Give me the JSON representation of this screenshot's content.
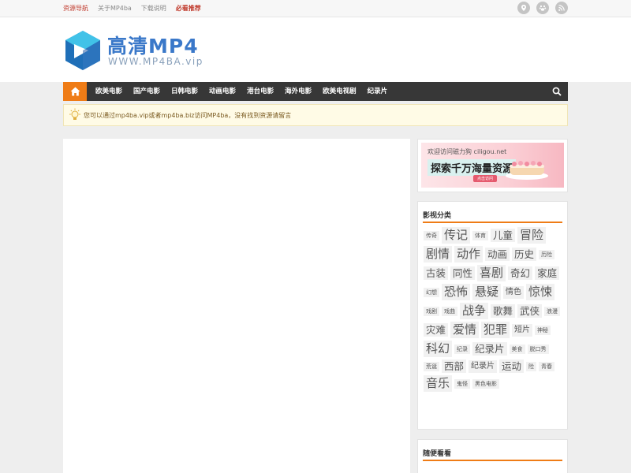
{
  "topbar": {
    "links": [
      {
        "label": "资源导航",
        "style": "red"
      },
      {
        "label": "关于MP4ba",
        "style": "normal"
      },
      {
        "label": "下载说明",
        "style": "normal"
      },
      {
        "label": "必看推荐",
        "style": "red-bold"
      }
    ],
    "icons": [
      "location-icon",
      "paw-icon",
      "rss-icon"
    ]
  },
  "header": {
    "logo_title": "高清MP4",
    "logo_subtitle": "WWW.MP4BA.vip"
  },
  "nav": {
    "items": [
      "欧美电影",
      "国产电影",
      "日韩电影",
      "动画电影",
      "港台电影",
      "海外电影",
      "欧美电视剧",
      "纪录片"
    ]
  },
  "notice": {
    "text": "您可以通过mp4ba.vip或者mp4ba.biz访问MP4ba，没有找到资源请留言"
  },
  "ad": {
    "small_text": "欢迎访问磁力狗 ciligou.net",
    "big_text": "探索千万海量资源",
    "button": "点击访问"
  },
  "categories": {
    "title": "影视分类",
    "tags": [
      {
        "label": "传奇",
        "size": 1
      },
      {
        "label": "传记",
        "size": 4
      },
      {
        "label": "体育",
        "size": 1
      },
      {
        "label": "儿童",
        "size": 3
      },
      {
        "label": "冒险",
        "size": 4
      },
      {
        "label": "剧情",
        "size": 4
      },
      {
        "label": "动作",
        "size": 4
      },
      {
        "label": "动画",
        "size": 3
      },
      {
        "label": "历史",
        "size": 3
      },
      {
        "label": "历险",
        "size": 1
      },
      {
        "label": "古装",
        "size": 3
      },
      {
        "label": "同性",
        "size": 3
      },
      {
        "label": "喜剧",
        "size": 4
      },
      {
        "label": "奇幻",
        "size": 3
      },
      {
        "label": "家庭",
        "size": 3
      },
      {
        "label": "幻想",
        "size": 1
      },
      {
        "label": "恐怖",
        "size": 4
      },
      {
        "label": "悬疑",
        "size": 4
      },
      {
        "label": "情色",
        "size": 2
      },
      {
        "label": "惊悚",
        "size": 4
      },
      {
        "label": "戏剧",
        "size": 1
      },
      {
        "label": "戏曲",
        "size": 1
      },
      {
        "label": "战争",
        "size": 4
      },
      {
        "label": "歌舞",
        "size": 3
      },
      {
        "label": "武侠",
        "size": 3
      },
      {
        "label": "浪漫",
        "size": 1
      },
      {
        "label": "灾难",
        "size": 3
      },
      {
        "label": "爱情",
        "size": 4
      },
      {
        "label": "犯罪",
        "size": 4
      },
      {
        "label": "短片",
        "size": 2
      },
      {
        "label": "神秘",
        "size": 1
      },
      {
        "label": "科幻",
        "size": 4
      },
      {
        "label": "纪录",
        "size": 1
      },
      {
        "label": "纪录片",
        "size": 3
      },
      {
        "label": "美食",
        "size": 1
      },
      {
        "label": "脱口秀",
        "size": 1
      },
      {
        "label": "荒诞",
        "size": 1
      },
      {
        "label": "西部",
        "size": 3
      },
      {
        "label": "纪录片",
        "size": 2
      },
      {
        "label": "运动",
        "size": 3
      },
      {
        "label": "险",
        "size": 1
      },
      {
        "label": "青春",
        "size": 1
      },
      {
        "label": "音乐",
        "size": 4
      },
      {
        "label": "鬼怪",
        "size": 1
      },
      {
        "label": "黑色电影",
        "size": 1
      }
    ]
  },
  "random": {
    "title": "随便看看"
  },
  "colors": {
    "accent": "#ef7c16",
    "nav_bg": "#373737",
    "link_red": "#c0392b",
    "logo_blue": "#3a78c9"
  }
}
